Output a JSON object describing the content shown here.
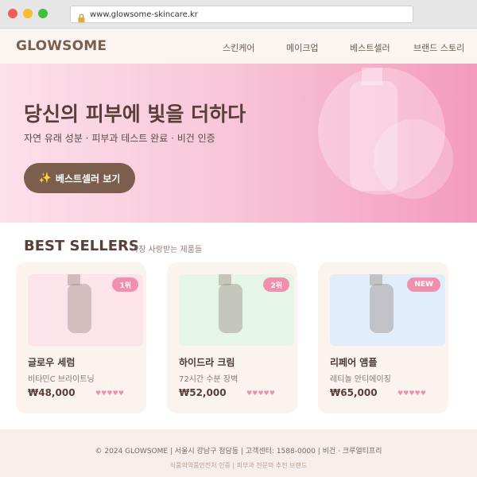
{
  "browser": {
    "url": "www.glowsome-skincare.kr",
    "lock_icon": "lock-icon"
  },
  "header": {
    "logo": "GLOWSOME",
    "nav": [
      {
        "label": "스킨케어"
      },
      {
        "label": "메이크업"
      },
      {
        "label": "베스트셀러"
      },
      {
        "label": "브랜드 스토리"
      }
    ]
  },
  "hero": {
    "title": "당신의 피부에 빛을 더하다",
    "subtitle": "자연 유래 성분 · 피부과 테스트 완료 · 비건 인증",
    "button_icon": "✨",
    "button_label": "베스트셀러 보기",
    "colors": {
      "start": "#fce0ea",
      "end": "#f49bbd"
    }
  },
  "bestsellers": {
    "title": "BEST SELLERS",
    "subtitle": "가장 사랑받는 제품들",
    "products": [
      {
        "badge": "1위",
        "name": "글로우 세럼",
        "desc": "비타민C 브라이트닝",
        "price": "₩48,000",
        "hearts": "♥♥♥♥♥",
        "image_bg": "#fce4ea"
      },
      {
        "badge": "2위",
        "name": "하이드라 크림",
        "desc": "72시간 수분 장벽",
        "price": "₩52,000",
        "hearts": "♥♥♥♥♥",
        "image_bg": "#e5f5e6"
      },
      {
        "badge": "NEW",
        "name": "리페어 앰플",
        "desc": "레티놀 안티에이징",
        "price": "₩65,000",
        "hearts": "♥♥♥♥♥",
        "image_bg": "#e0eefb"
      }
    ]
  },
  "footer": {
    "line1": "© 2024 GLOWSOME | 서울시 강남구 청담동 | 고객센터: 1588-0000 | 비건 · 크루얼티프리",
    "line2": "식품의약품안전처 인증 | 피부과 전문의 추천 브랜드"
  }
}
